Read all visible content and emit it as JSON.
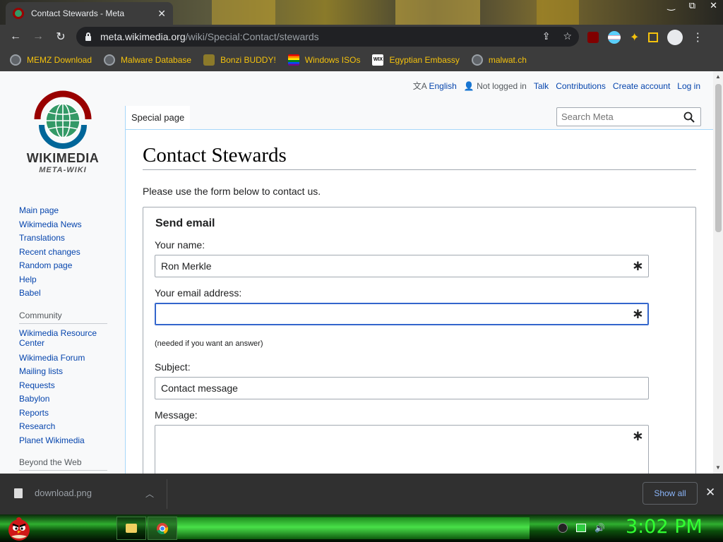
{
  "browser": {
    "tab_title": "Contact Stewards - Meta",
    "tab_close": "✕",
    "url_host": "meta.wikimedia.org",
    "url_path": "/wiki/Special:Contact/stewards",
    "window_controls": [
      "‿",
      "⧉",
      "✕"
    ]
  },
  "bookmarks": [
    {
      "label": "MEMZ Download",
      "icon": "globe-icon"
    },
    {
      "label": "Malware Database",
      "icon": "globe-icon"
    },
    {
      "label": "Bonzi BUDDY!",
      "icon": "bonzi-icon"
    },
    {
      "label": "Windows ISOs",
      "icon": "rainbow-flag-icon"
    },
    {
      "label": "Egyptian Embassy",
      "icon": "wix-icon"
    },
    {
      "label": "malwat.ch",
      "icon": "globe-icon"
    }
  ],
  "logo": {
    "title": "WIKIMEDIA",
    "subtitle": "META-WIKI"
  },
  "personal_tools": {
    "language": "English",
    "not_logged_in": "Not logged in",
    "talk": "Talk",
    "contributions": "Contributions",
    "create_account": "Create account",
    "login": "Log in"
  },
  "nav": {
    "main": [
      "Main page",
      "Wikimedia News",
      "Translations",
      "Recent changes",
      "Random page",
      "Help",
      "Babel"
    ],
    "community_heading": "Community",
    "community": [
      "Wikimedia Resource Center",
      "Wikimedia Forum",
      "Mailing lists",
      "Requests",
      "Babylon",
      "Reports",
      "Research",
      "Planet Wikimedia"
    ],
    "beyond_heading": "Beyond the Web"
  },
  "tabs": {
    "special_page": "Special page"
  },
  "search": {
    "placeholder": "Search Meta"
  },
  "content": {
    "title": "Contact Stewards",
    "intro": "Please use the form below to contact us.",
    "legend": "Send email",
    "name_label": "Your name:",
    "name_value": "Ron Merkle",
    "email_label": "Your email address:",
    "email_value": "",
    "email_hint": "(needed if you want an answer)",
    "subject_label": "Subject:",
    "subject_value": "Contact message",
    "message_label": "Message:",
    "required_mark": "∗"
  },
  "downloads": {
    "file": "download.png",
    "show_all": "Show all",
    "close": "✕"
  },
  "taskbar": {
    "clock": "3:02 PM"
  },
  "colors": {
    "link": "#0645ad",
    "clock": "#32ff32",
    "bookmark_text": "#f4c20d",
    "focus": "#3366cc"
  }
}
